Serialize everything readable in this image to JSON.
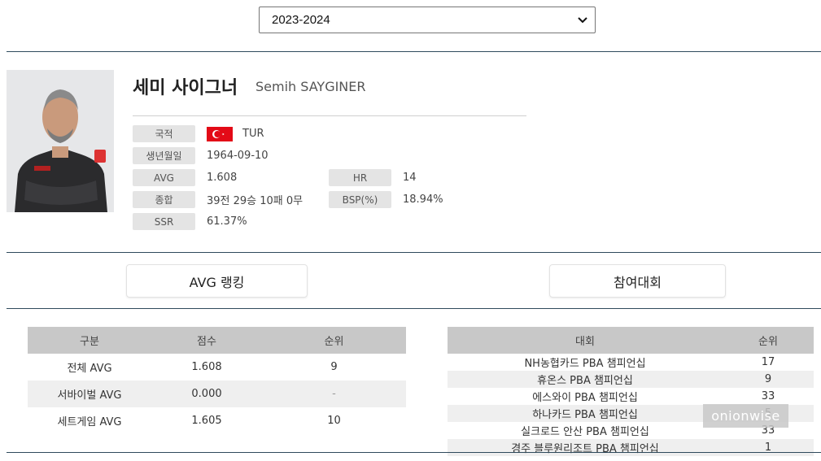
{
  "season": {
    "selected": "2023-2024"
  },
  "player": {
    "name_ko": "세미 사이그너",
    "name_en": "Semih SAYGINER"
  },
  "info": {
    "nationality_label": "국적",
    "nationality_value": "TUR",
    "birth_label": "생년월일",
    "birth_value": "1964-09-10",
    "avg_label": "AVG",
    "avg_value": "1.608",
    "hr_label": "HR",
    "hr_value": "14",
    "total_label": "종합",
    "total_value": "39전 29승 10패 0무",
    "bsp_label": "BSP(%)",
    "bsp_value": "18.94%",
    "ssr_label": "SSR",
    "ssr_value": "61.37%"
  },
  "tabs": {
    "avg_ranking": "AVG 랭킹",
    "tournaments": "참여대회"
  },
  "rank_table": {
    "headers": [
      "구분",
      "점수",
      "순위"
    ],
    "rows": [
      [
        "전체 AVG",
        "1.608",
        "9"
      ],
      [
        "서바이벌 AVG",
        "0.000",
        "-"
      ],
      [
        "세트게임 AVG",
        "1.605",
        "10"
      ]
    ]
  },
  "tour_table": {
    "headers": [
      "대회",
      "순위"
    ],
    "rows": [
      [
        "NH농협카드 PBA 챔피언십",
        "17"
      ],
      [
        "휴온스 PBA 챔피언십",
        "9"
      ],
      [
        "에스와이 PBA 챔피언십",
        "33"
      ],
      [
        "하나카드 PBA 챔피언십",
        "5"
      ],
      [
        "실크로드 안산 PBA 챔피언십",
        "33"
      ],
      [
        "경주 블루원리조트 PBA 챔피언십",
        "1"
      ]
    ]
  },
  "watermark": "onionwise",
  "colors": {
    "divider": "#2f4a5c",
    "header_bg": "#c8c8c8",
    "label_bg": "#e4e4e4",
    "flag_red": "#e30a17"
  },
  "icons": {
    "select": "chevron-down-icon",
    "flag": "turkey-flag-icon"
  }
}
